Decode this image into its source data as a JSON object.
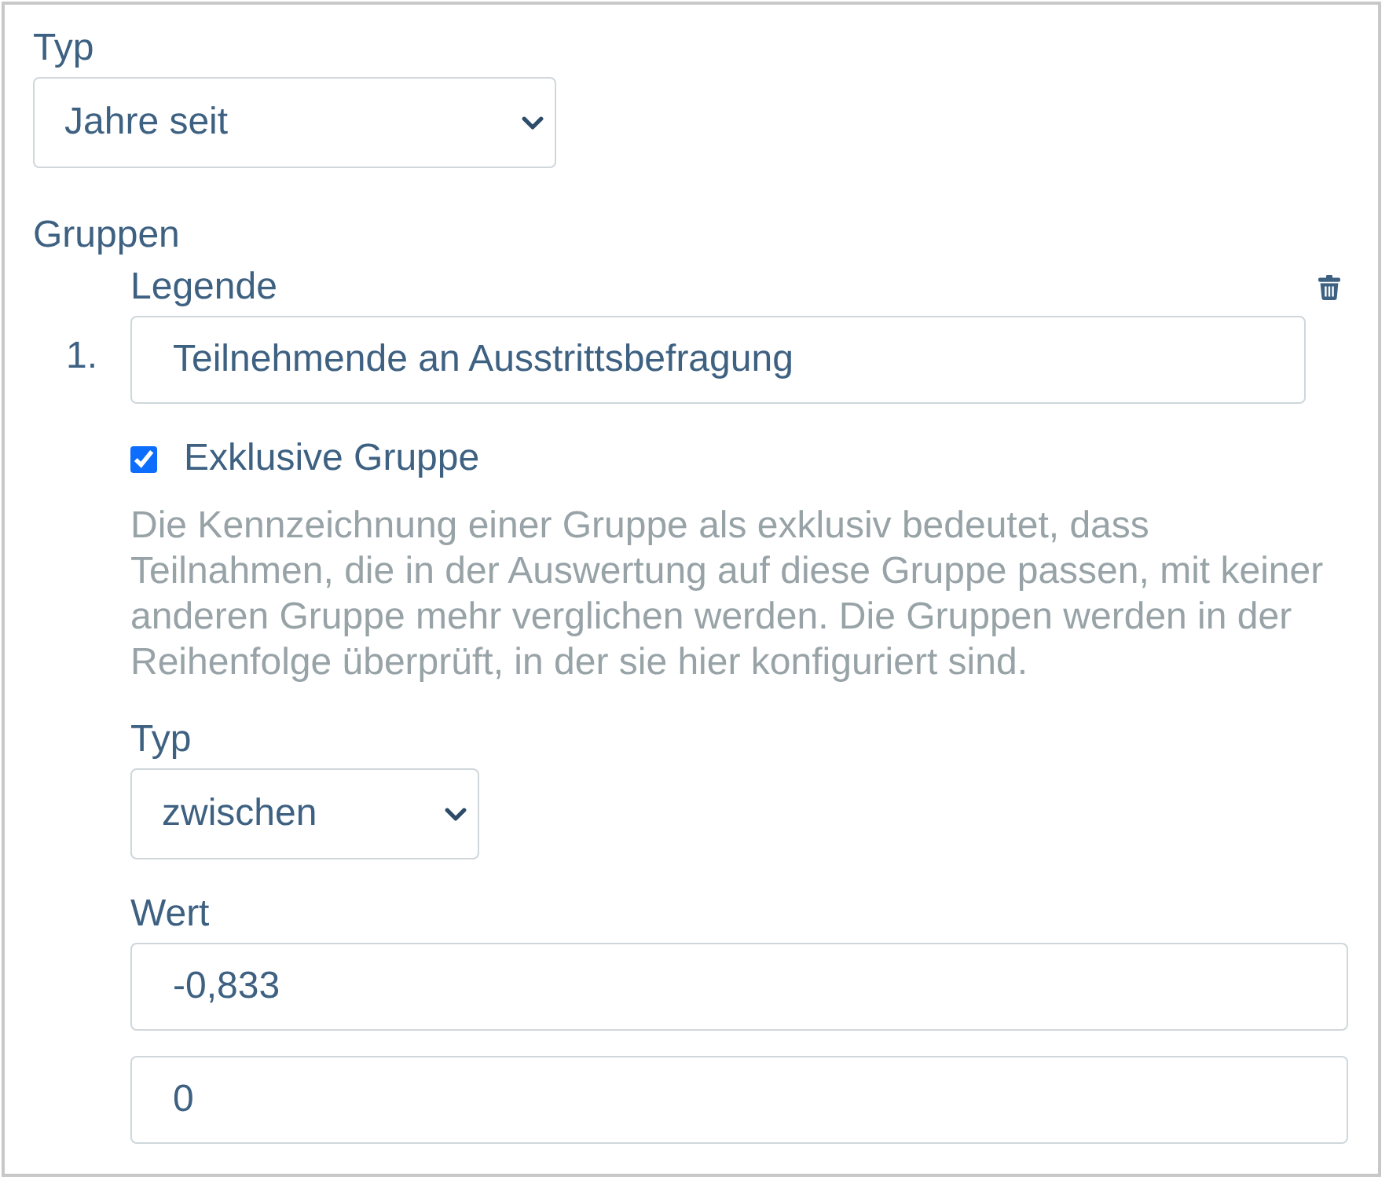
{
  "type_field": {
    "label": "Typ",
    "value": "Jahre seit"
  },
  "groups": {
    "label": "Gruppen",
    "items": [
      {
        "number": "1.",
        "legend": {
          "label": "Legende",
          "value": "Teilnehmende an Ausstrittsbefragung"
        },
        "exclusive": {
          "label": "Exklusive Gruppe",
          "checked": true,
          "hint": "Die Kennzeichnung einer Gruppe als exklusiv bedeutet, dass Teilnahmen, die in der Auswertung auf diese Gruppe passen, mit keiner anderen Gruppe mehr verglichen werden. Die Gruppen werden in der Reihenfolge überprüft, in der sie hier konfiguriert sind."
        },
        "type_field": {
          "label": "Typ",
          "value": "zwischen"
        },
        "value_field": {
          "label": "Wert",
          "values": [
            "-0,833",
            "0"
          ]
        }
      }
    ]
  }
}
